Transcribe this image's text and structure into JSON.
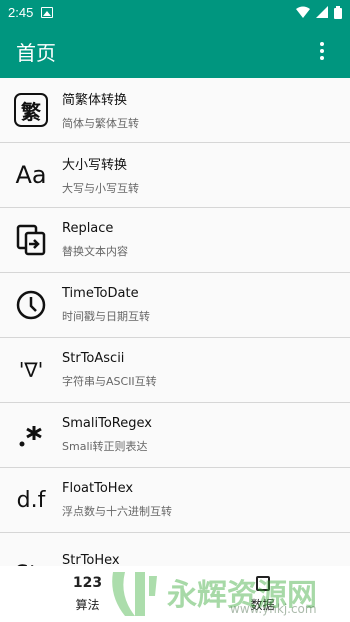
{
  "status": {
    "time": "2:45"
  },
  "app": {
    "title": "首页"
  },
  "items": [
    {
      "title": "简繁体转换",
      "subtitle": "简体与繁体互转",
      "icon": "繁"
    },
    {
      "title": "大小写转换",
      "subtitle": "大写与小写互转",
      "icon": "Aa"
    },
    {
      "title": "Replace",
      "subtitle": "替换文本内容",
      "icon": "replace-icon"
    },
    {
      "title": "TimeToDate",
      "subtitle": "时间戳与日期互转",
      "icon": "clock-icon"
    },
    {
      "title": "StrToAscii",
      "subtitle": "字符串与ASCII互转",
      "icon": "'∇'"
    },
    {
      "title": "SmaliToRegex",
      "subtitle": "Smali转正则表达",
      "icon": ".*"
    },
    {
      "title": "FloatToHex",
      "subtitle": "浮点数与十六进制互转",
      "icon": "d.f"
    },
    {
      "title": "StrToHex",
      "subtitle": "",
      "icon": "Str"
    }
  ],
  "nav": [
    {
      "icon": "123",
      "label": "算法"
    },
    {
      "icon": "",
      "label": "数据"
    }
  ],
  "watermark": {
    "text": "永辉资源网",
    "url": "www.yhkj.com"
  },
  "colors": {
    "primary": "#00967f"
  }
}
